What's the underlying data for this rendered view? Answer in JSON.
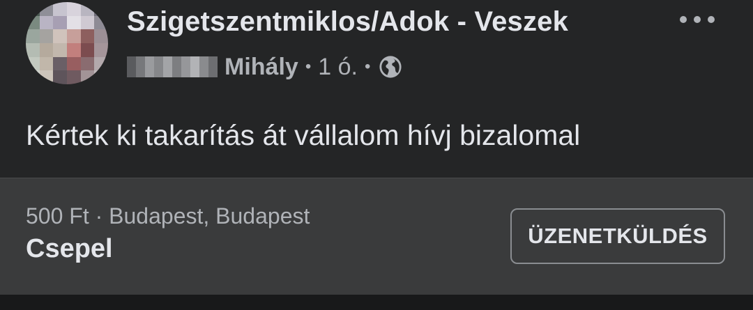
{
  "post": {
    "group_name": "Szigetszentmiklos/Adok - Veszek",
    "author_visible_name": "Mihály",
    "time_ago": "1 ó.",
    "separator": "•",
    "privacy_icon": "globe-icon",
    "more_icon": "more-options-icon",
    "message": "Kértek ki takarítás át vállalom hívj bizalomal"
  },
  "listing": {
    "price_location": "500 Ft · Budapest, Budapest",
    "title": "Csepel",
    "button_label": "ÜZENETKÜLDÉS"
  },
  "colors": {
    "background": "#242526",
    "listing_background": "#3a3b3c",
    "primary_text": "#e4e6eb",
    "secondary_text": "#b0b3b8"
  }
}
